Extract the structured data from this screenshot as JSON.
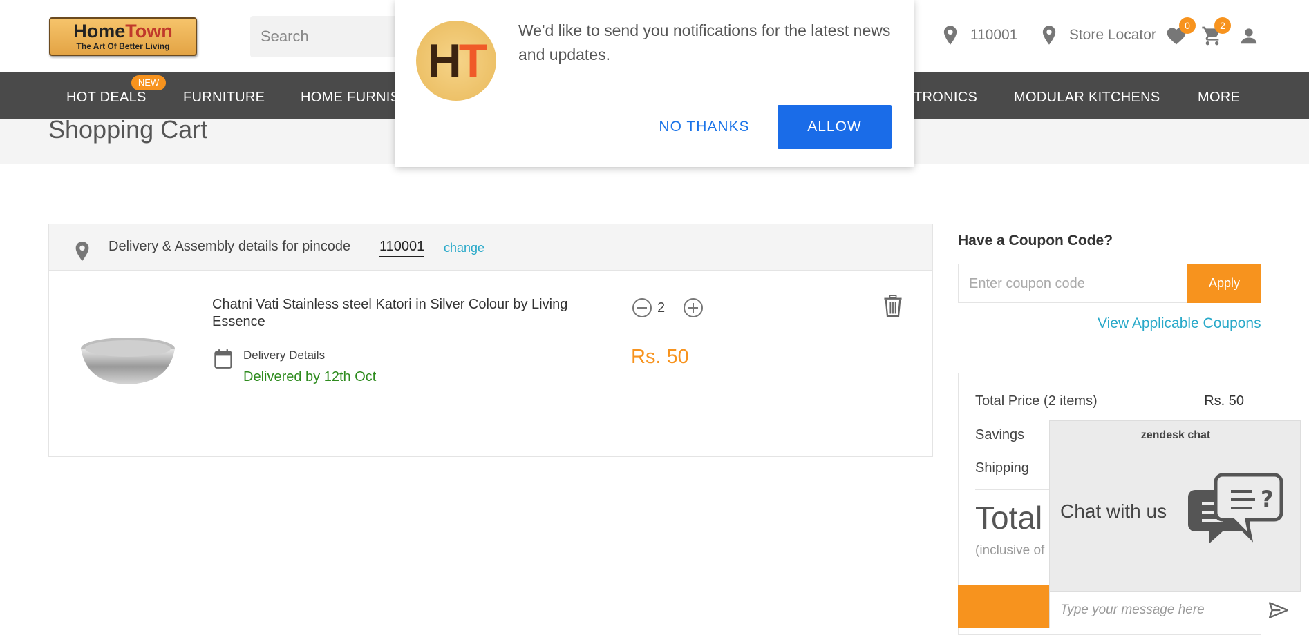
{
  "header": {
    "logo_main": "Home",
    "logo_accent": "Town",
    "logo_tagline": "The Art Of Better Living",
    "search_placeholder": "Search",
    "pincode": "110001",
    "store_locator": "Store Locator",
    "wishlist_count": "0",
    "cart_count": "2"
  },
  "nav": {
    "new_badge": "NEW",
    "items": [
      "HOT DEALS",
      "FURNITURE",
      "HOME FURNIS",
      "TRONICS",
      "MODULAR KITCHENS",
      "MORE"
    ]
  },
  "page": {
    "title": "Shopping Cart"
  },
  "cart": {
    "delivery_label": "Delivery & Assembly details for pincode",
    "pincode": "110001",
    "change_link": "change",
    "item": {
      "name": "Chatni Vati Stainless steel Katori in Silver Colour by Living Essence",
      "delivery_details_label": "Delivery Details",
      "delivery_date": "Delivered by 12th Oct",
      "quantity": "2",
      "price": "Rs. 50"
    }
  },
  "coupon": {
    "heading": "Have a Coupon Code?",
    "placeholder": "Enter coupon code",
    "apply_label": "Apply",
    "view_link": "View Applicable Coupons"
  },
  "summary": {
    "total_price_label": "Total Price (2 items)",
    "total_price_value": "Rs. 50",
    "savings_label": "Savings",
    "shipping_label": "Shipping",
    "total_label": "Total",
    "inclusive_note": "(inclusive of"
  },
  "notification_popup": {
    "logo_h": "H",
    "logo_t": "T",
    "message": "We'd like to send you notifications for the latest news and updates.",
    "no_thanks": "NO THANKS",
    "allow": "ALLOW"
  },
  "chat_widget": {
    "brand": "zendesk chat",
    "title": "Chat with us",
    "input_placeholder": "Type your message here"
  },
  "colors": {
    "accent_orange": "#f7931e",
    "nav_bg": "#4a4a4a",
    "link_blue": "#29a9c9",
    "allow_blue": "#1a6ce8",
    "delivery_green": "#2e8b1e"
  }
}
